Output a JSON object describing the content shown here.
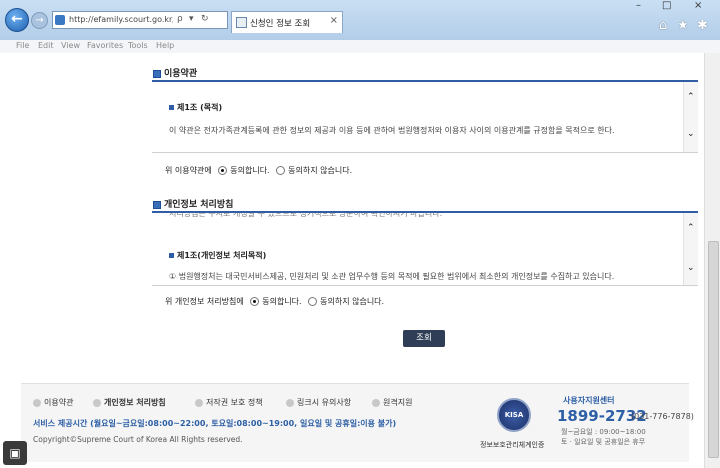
{
  "browser": {
    "url": "http://efamily.scourt.go.kr/pt/Pt",
    "tab_title": "신청인 정보 조회",
    "tab_close": "×",
    "addr_icons": {
      "search": "ρ",
      "dropdown": "▾",
      "refresh": "↻"
    },
    "window_controls": {
      "minimize": "–",
      "maximize": "□",
      "close": "×"
    },
    "menu": [
      "File",
      "Edit",
      "View",
      "Favorites",
      "Tools",
      "Help"
    ]
  },
  "terms": {
    "title": "이용약관",
    "article_title": "제1조 (목적)",
    "article_text": "이 약관은 전자가족관계등록에 관한 정보의 제공과 이용 등에 관하여 법원행정처와 이용자 사이의 이용관계를 규정함을 목적으로 한다.",
    "question": "위 이용약관에",
    "agree": "동의합니다.",
    "disagree": "동의하지 않습니다."
  },
  "privacy": {
    "title": "개인정보 처리방침",
    "partial_text": "처리방침은 수시로 개정될 수 있으므로 정기적으로 방문하여 확인하시기 바랍니다.",
    "article_title": "제1조(개인정보 처리목적)",
    "article_text": "① 법원행정처는 대국민서비스제공, 민원처리 및 소관 업무수행 등의 목적에 필요한 범위에서 최소한의 개인정보를 수집하고 있습니다.",
    "question": "위 개인정보 처리방침에",
    "agree": "동의합니다.",
    "disagree": "동의하지 않습니다."
  },
  "query_button": "조회",
  "footer": {
    "links": [
      "이용약관",
      "개인정보 처리방침",
      "저작권 보호 정책",
      "링크시 유의사항",
      "원격지원"
    ],
    "hours": "서비스 제공시간 (월요일~금요일:08:00~22:00, 토요일:08:00~19:00, 일요일 및 공휴일:이용 불가)",
    "copyright": "Copyright©Supreme Court of Korea All Rights reserved.",
    "kisa_logo": "KISA",
    "kisa_caption": "정보보호관리체계인증",
    "support_title": "사용자지원센터",
    "support_phone": "1899-2732",
    "support_phone2": "(031-776-7878)",
    "support_weekday": "월~금요일 : 09:00~18:00",
    "support_weekend": "토 · 일요일 및 공휴일은 휴무"
  },
  "icons": [
    "back-arrow-icon",
    "forward-arrow-icon",
    "home-icon",
    "star-icon",
    "gear-icon",
    "scroll-up-icon",
    "scroll-down-icon"
  ]
}
